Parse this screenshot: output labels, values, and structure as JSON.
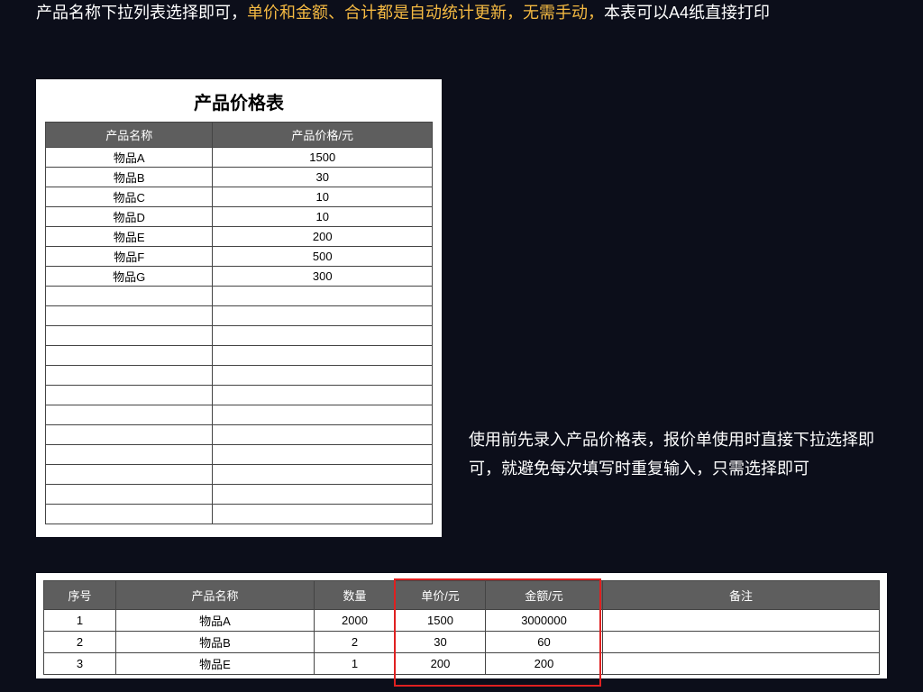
{
  "descTop": {
    "part1": "产品名称下拉列表选择即可，",
    "highlight": "单价和金额、合计都是自动统计更新，无需手动，",
    "part2": "本表可以A4纸直接打印"
  },
  "priceTable": {
    "title": "产品价格表",
    "headers": [
      "产品名称",
      "产品价格/元"
    ],
    "rows": [
      [
        "物品A",
        "1500"
      ],
      [
        "物品B",
        "30"
      ],
      [
        "物品C",
        "10"
      ],
      [
        "物品D",
        "10"
      ],
      [
        "物品E",
        "200"
      ],
      [
        "物品F",
        "500"
      ],
      [
        "物品G",
        "300"
      ],
      [
        "",
        ""
      ],
      [
        "",
        ""
      ],
      [
        "",
        ""
      ],
      [
        "",
        ""
      ],
      [
        "",
        ""
      ],
      [
        "",
        ""
      ],
      [
        "",
        ""
      ],
      [
        "",
        ""
      ],
      [
        "",
        ""
      ],
      [
        "",
        ""
      ],
      [
        "",
        ""
      ],
      [
        "",
        ""
      ]
    ]
  },
  "descRight": "使用前先录入产品价格表，报价单使用时直接下拉选择即可，就避免每次填写时重复输入，只需选择即可",
  "quoteTable": {
    "headers": [
      "序号",
      "产品名称",
      "数量",
      "单价/元",
      "金额/元",
      "备注"
    ],
    "rows": [
      [
        "1",
        "物品A",
        "2000",
        "1500",
        "3000000",
        ""
      ],
      [
        "2",
        "物品B",
        "2",
        "30",
        "60",
        ""
      ],
      [
        "3",
        "物品E",
        "1",
        "200",
        "200",
        ""
      ]
    ]
  }
}
